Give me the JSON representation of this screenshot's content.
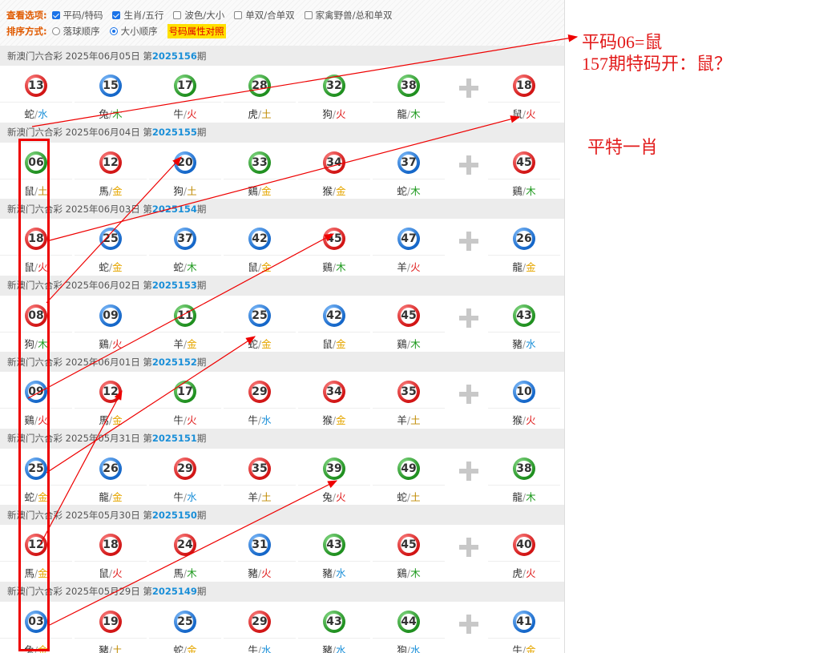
{
  "options": {
    "view_label": "查看选项:",
    "view_items": [
      {
        "label": "平码/特码",
        "checked": true
      },
      {
        "label": "生肖/五行",
        "checked": true
      },
      {
        "label": "波色/大小",
        "checked": false
      },
      {
        "label": "单双/合单双",
        "checked": false
      },
      {
        "label": "家禽野兽/总和单双",
        "checked": false
      }
    ],
    "sort_label": "排序方式:",
    "sort_items": [
      {
        "label": "落球顺序",
        "checked": false
      },
      {
        "label": "大小顺序",
        "checked": true
      }
    ],
    "attr_link": "号码属性对照"
  },
  "element_colors": {
    "金": "#e6a700",
    "木": "#1f9a1f",
    "水": "#1a8fd8",
    "火": "#e02020",
    "土": "#c08a00"
  },
  "draws": [
    {
      "title": "新澳门六合彩 2025年06月05日 第",
      "issue": "2025156",
      "suffix": "期",
      "balls": [
        {
          "n": "13",
          "c": "red",
          "z": "蛇",
          "e": "水"
        },
        {
          "n": "15",
          "c": "blue",
          "z": "兔",
          "e": "木"
        },
        {
          "n": "17",
          "c": "green",
          "z": "牛",
          "e": "火"
        },
        {
          "n": "28",
          "c": "green",
          "z": "虎",
          "e": "土"
        },
        {
          "n": "32",
          "c": "green",
          "z": "狗",
          "e": "火"
        },
        {
          "n": "38",
          "c": "green",
          "z": "龍",
          "e": "木"
        }
      ],
      "special": {
        "n": "18",
        "c": "red",
        "z": "鼠",
        "e": "火"
      }
    },
    {
      "title": "新澳门六合彩 2025年06月04日 第",
      "issue": "2025155",
      "suffix": "期",
      "balls": [
        {
          "n": "06",
          "c": "green",
          "z": "鼠",
          "e": "土"
        },
        {
          "n": "12",
          "c": "red",
          "z": "馬",
          "e": "金"
        },
        {
          "n": "20",
          "c": "blue",
          "z": "狗",
          "e": "土"
        },
        {
          "n": "33",
          "c": "green",
          "z": "鷄",
          "e": "金"
        },
        {
          "n": "34",
          "c": "red",
          "z": "猴",
          "e": "金"
        },
        {
          "n": "37",
          "c": "blue",
          "z": "蛇",
          "e": "木"
        }
      ],
      "special": {
        "n": "45",
        "c": "red",
        "z": "鷄",
        "e": "木"
      }
    },
    {
      "title": "新澳门六合彩 2025年06月03日 第",
      "issue": "2025154",
      "suffix": "期",
      "balls": [
        {
          "n": "18",
          "c": "red",
          "z": "鼠",
          "e": "火"
        },
        {
          "n": "25",
          "c": "blue",
          "z": "蛇",
          "e": "金"
        },
        {
          "n": "37",
          "c": "blue",
          "z": "蛇",
          "e": "木"
        },
        {
          "n": "42",
          "c": "blue",
          "z": "鼠",
          "e": "金"
        },
        {
          "n": "45",
          "c": "red",
          "z": "鷄",
          "e": "木"
        },
        {
          "n": "47",
          "c": "blue",
          "z": "羊",
          "e": "火"
        }
      ],
      "special": {
        "n": "26",
        "c": "blue",
        "z": "龍",
        "e": "金"
      }
    },
    {
      "title": "新澳门六合彩 2025年06月02日 第",
      "issue": "2025153",
      "suffix": "期",
      "balls": [
        {
          "n": "08",
          "c": "red",
          "z": "狗",
          "e": "木"
        },
        {
          "n": "09",
          "c": "blue",
          "z": "鷄",
          "e": "火"
        },
        {
          "n": "11",
          "c": "green",
          "z": "羊",
          "e": "金"
        },
        {
          "n": "25",
          "c": "blue",
          "z": "蛇",
          "e": "金"
        },
        {
          "n": "42",
          "c": "blue",
          "z": "鼠",
          "e": "金"
        },
        {
          "n": "45",
          "c": "red",
          "z": "鷄",
          "e": "木"
        }
      ],
      "special": {
        "n": "43",
        "c": "green",
        "z": "豬",
        "e": "水"
      }
    },
    {
      "title": "新澳门六合彩 2025年06月01日 第",
      "issue": "2025152",
      "suffix": "期",
      "balls": [
        {
          "n": "09",
          "c": "blue",
          "z": "鷄",
          "e": "火"
        },
        {
          "n": "12",
          "c": "red",
          "z": "馬",
          "e": "金"
        },
        {
          "n": "17",
          "c": "green",
          "z": "牛",
          "e": "火"
        },
        {
          "n": "29",
          "c": "red",
          "z": "牛",
          "e": "水"
        },
        {
          "n": "34",
          "c": "red",
          "z": "猴",
          "e": "金"
        },
        {
          "n": "35",
          "c": "red",
          "z": "羊",
          "e": "土"
        }
      ],
      "special": {
        "n": "10",
        "c": "blue",
        "z": "猴",
        "e": "火"
      }
    },
    {
      "title": "新澳门六合彩 2025年05月31日 第",
      "issue": "2025151",
      "suffix": "期",
      "balls": [
        {
          "n": "25",
          "c": "blue",
          "z": "蛇",
          "e": "金"
        },
        {
          "n": "26",
          "c": "blue",
          "z": "龍",
          "e": "金"
        },
        {
          "n": "29",
          "c": "red",
          "z": "牛",
          "e": "水"
        },
        {
          "n": "35",
          "c": "red",
          "z": "羊",
          "e": "土"
        },
        {
          "n": "39",
          "c": "green",
          "z": "兔",
          "e": "火"
        },
        {
          "n": "49",
          "c": "green",
          "z": "蛇",
          "e": "土"
        }
      ],
      "special": {
        "n": "38",
        "c": "green",
        "z": "龍",
        "e": "木"
      }
    },
    {
      "title": "新澳门六合彩 2025年05月30日 第",
      "issue": "2025150",
      "suffix": "期",
      "balls": [
        {
          "n": "12",
          "c": "red",
          "z": "馬",
          "e": "金"
        },
        {
          "n": "18",
          "c": "red",
          "z": "鼠",
          "e": "火"
        },
        {
          "n": "24",
          "c": "red",
          "z": "馬",
          "e": "木"
        },
        {
          "n": "31",
          "c": "blue",
          "z": "豬",
          "e": "火"
        },
        {
          "n": "43",
          "c": "green",
          "z": "豬",
          "e": "水"
        },
        {
          "n": "45",
          "c": "red",
          "z": "鷄",
          "e": "木"
        }
      ],
      "special": {
        "n": "40",
        "c": "red",
        "z": "虎",
        "e": "火"
      }
    },
    {
      "title": "新澳门六合彩 2025年05月29日 第",
      "issue": "2025149",
      "suffix": "期",
      "balls": [
        {
          "n": "03",
          "c": "blue",
          "z": "兔",
          "e": "金"
        },
        {
          "n": "19",
          "c": "red",
          "z": "豬",
          "e": "土"
        },
        {
          "n": "25",
          "c": "blue",
          "z": "蛇",
          "e": "金"
        },
        {
          "n": "29",
          "c": "red",
          "z": "牛",
          "e": "水"
        },
        {
          "n": "43",
          "c": "green",
          "z": "豬",
          "e": "水"
        },
        {
          "n": "44",
          "c": "green",
          "z": "狗",
          "e": "水"
        }
      ],
      "special": {
        "n": "41",
        "c": "blue",
        "z": "牛",
        "e": "金"
      }
    }
  ],
  "notes": {
    "line1": "平码06=鼠",
    "line2": "157期特码开：鼠？",
    "line3": "平特一肖"
  }
}
